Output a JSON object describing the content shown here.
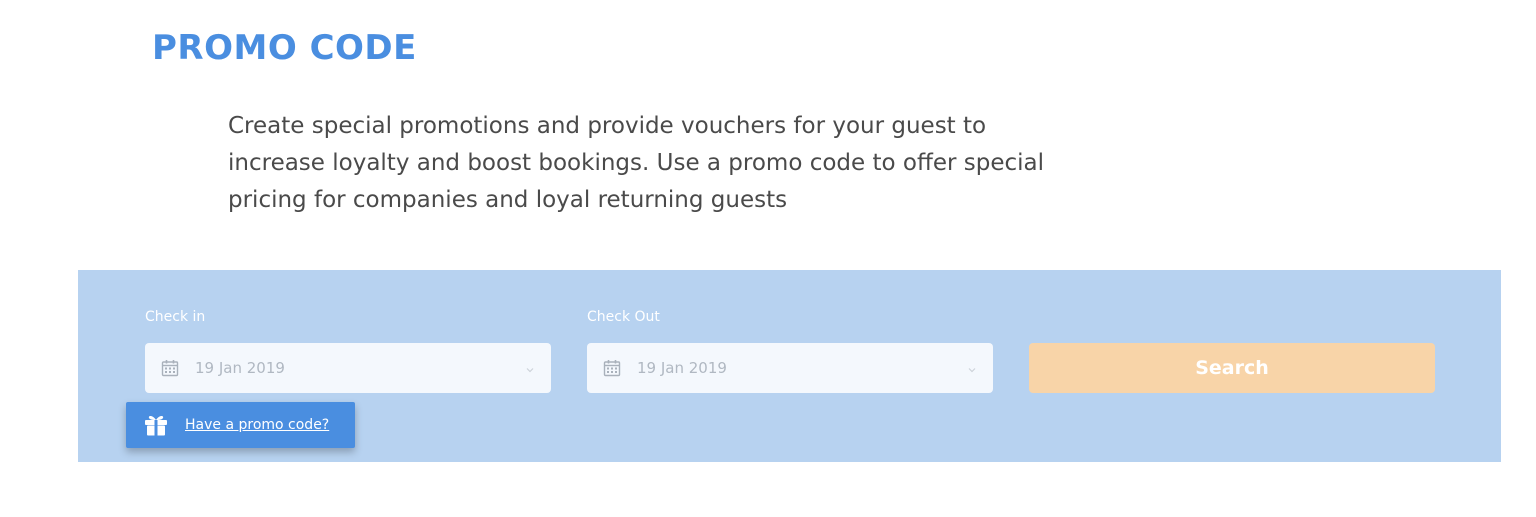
{
  "header": {
    "title": "PROMO CODE"
  },
  "intro": {
    "text": "Create special promotions and provide vouchers for your guest to increase loyalty and boost bookings. Use a promo code to offer special pricing for companies and loyal returning guests"
  },
  "booking_form": {
    "check_in": {
      "label": "Check in",
      "value": "19 Jan 2019",
      "icon": "calendar-icon"
    },
    "check_out": {
      "label": "Check Out",
      "value": "19 Jan 2019",
      "icon": "calendar-icon"
    },
    "search_label": "Search",
    "promo": {
      "link_text": "Have a promo code?",
      "icon": "gift-icon"
    }
  },
  "colors": {
    "title": "#4a8ee0",
    "panel_background": "#b7d2f0",
    "search_button": "#f8d4a8",
    "promo_badge": "#4a8ee0",
    "body_text": "#4a4a4a"
  }
}
